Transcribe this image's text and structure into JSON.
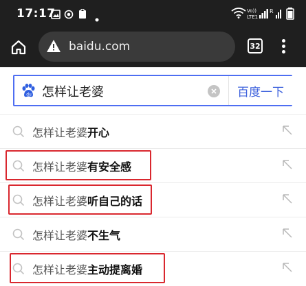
{
  "status_bar": {
    "time": "17:17",
    "network_label": "Vo)) LTE1 ull"
  },
  "toolbar": {
    "url": "baidu.com",
    "tab_count": "32"
  },
  "search": {
    "query": "怎样让老婆",
    "button_label": "百度一下",
    "accent": "#4e6ef2"
  },
  "suggestions": [
    {
      "prefix": "怎样让老婆",
      "suffix": "开心",
      "highlighted": false
    },
    {
      "prefix": "怎样让老婆",
      "suffix": "有安全感",
      "highlighted": true
    },
    {
      "prefix": "怎样让老婆",
      "suffix": "听自己的话",
      "highlighted": true
    },
    {
      "prefix": "怎样让老婆",
      "suffix": "不生气",
      "highlighted": false
    },
    {
      "prefix": "怎样让老婆",
      "suffix": "主动提离婚",
      "highlighted": true
    }
  ],
  "colors": {
    "highlight_box": "#d9272e",
    "toolbar_bg": "#1f1f1f"
  }
}
